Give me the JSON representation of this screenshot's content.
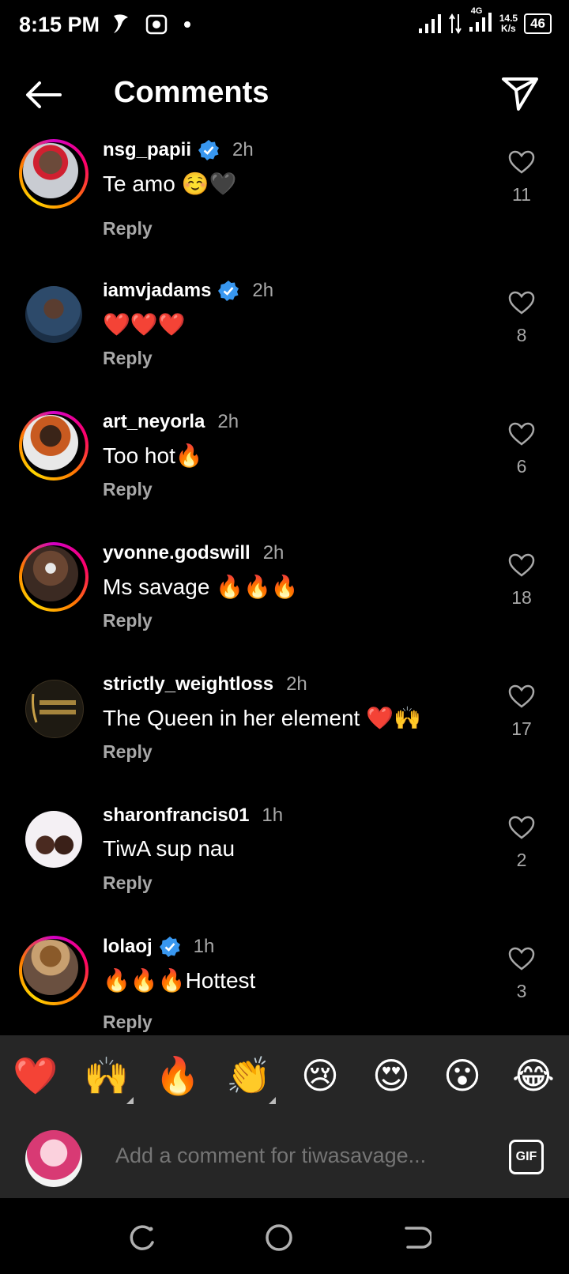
{
  "status": {
    "time": "8:15 PM",
    "network_type": "4G",
    "speed_value": "14.5",
    "speed_unit": "K/s",
    "battery": "46"
  },
  "header": {
    "title": "Comments"
  },
  "comments": [
    {
      "username": "nsg_papii",
      "verified": true,
      "time": "2h",
      "text": "Te amo ☺️🖤",
      "reply": "Reply",
      "likes": "11"
    },
    {
      "username": "iamvjadams",
      "verified": true,
      "time": "2h",
      "text": "❤️❤️❤️",
      "reply": "Reply",
      "likes": "8"
    },
    {
      "username": "art_neyorla",
      "verified": false,
      "time": "2h",
      "text": "Too hot🔥",
      "reply": "Reply",
      "likes": "6"
    },
    {
      "username": "yvonne.godswill",
      "verified": false,
      "time": "2h",
      "text": "Ms savage 🔥🔥🔥",
      "reply": "Reply",
      "likes": "18"
    },
    {
      "username": "strictly_weightloss",
      "verified": false,
      "time": "2h",
      "text": "The Queen in her element ❤️🙌",
      "reply": "Reply",
      "likes": "17"
    },
    {
      "username": "sharonfrancis01",
      "verified": false,
      "time": "1h",
      "text": "TiwA sup nau",
      "reply": "Reply",
      "likes": "2"
    },
    {
      "username": "lolaoj",
      "verified": true,
      "time": "1h",
      "text": "🔥🔥🔥Hottest",
      "reply": "Reply",
      "likes": "3"
    }
  ],
  "emoji_bar": [
    "❤️",
    "🙌",
    "🔥",
    "👏",
    "😢",
    "😍",
    "😮",
    "😂"
  ],
  "composer": {
    "placeholder": "Add a comment for tiwasavage...",
    "gif_label": "GIF"
  },
  "colors": {
    "background": "#000000",
    "secondary_text": "#a8a8a8",
    "verified_blue": "#3897f0",
    "panel": "#262626"
  }
}
